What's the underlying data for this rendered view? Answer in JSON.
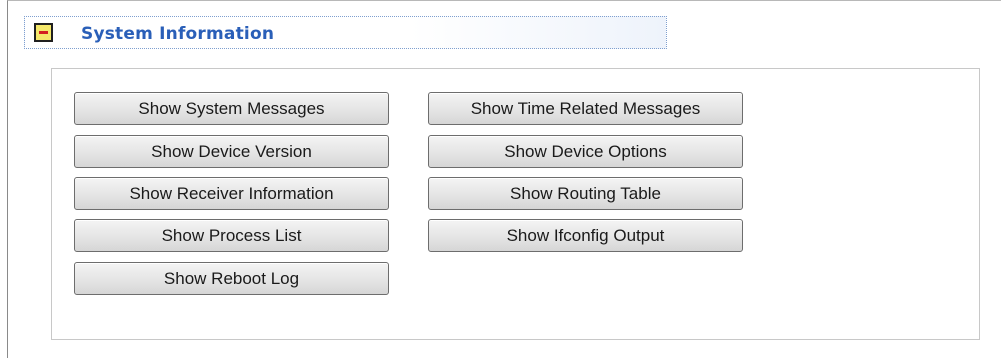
{
  "section": {
    "title": "System Information",
    "collapse_icon": "minus-square-icon"
  },
  "buttons": {
    "show_system_messages": "Show System Messages",
    "show_device_version": "Show Device Version",
    "show_receiver_information": "Show Receiver Information",
    "show_process_list": "Show Process List",
    "show_reboot_log": "Show Reboot Log",
    "show_time_related_messages": "Show Time Related Messages",
    "show_device_options": "Show Device Options",
    "show_routing_table": "Show Routing Table",
    "show_ifconfig_output": "Show Ifconfig Output"
  }
}
